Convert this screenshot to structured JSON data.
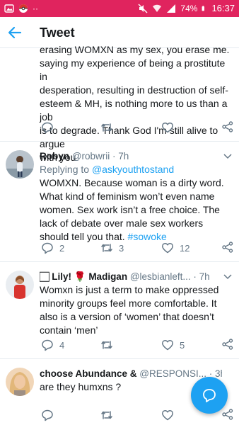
{
  "status_bar": {
    "battery": "74%",
    "time": "16:37"
  },
  "app_bar": {
    "title": "Tweet"
  },
  "cut_tweet": {
    "lines": [
      "erasing WOMXN as my sex, you erase me. By",
      "saying my experience of being a prostitute in",
      "desperation, resulting in destruction of self-",
      "esteem & MH, is nothing more to us than a job",
      "is to degrade. Thank God I'm still alive to argue",
      "with you"
    ]
  },
  "tweets": [
    {
      "name": "Robyn",
      "handle": "@robwrii",
      "time": "· 7h",
      "reply_prefix": "Replying to",
      "reply_mention": "@askyouthtostand",
      "text": "WOMXN. Because woman is a dirty word. What kind of feminism won’t even name women. Sex work isn’t a free choice. The lack of debate over male sex workers should tell you that.",
      "hashtag": "#sowoke",
      "replies": "2",
      "retweets": "3",
      "likes": "12"
    },
    {
      "name": "🏻 Lily! 🌹 Madigan",
      "handle": "@lesbianleft...",
      "time": "· 7h",
      "text": "Womxn is just a term to make oppressed minority groups feel more comfortable. It also is a version of ‘women’ that doesn’t contain ‘men’",
      "replies": "4",
      "retweets": "",
      "likes": "5"
    },
    {
      "name": "choose Abundance &",
      "handle": "@RESPONSI...",
      "time": "· 3h",
      "text": "are they humxns ?",
      "replies": "",
      "retweets": "",
      "likes": ""
    }
  ],
  "colors": {
    "status_bar": "#e0245e",
    "accent": "#1da1f2",
    "muted": "#657786"
  }
}
